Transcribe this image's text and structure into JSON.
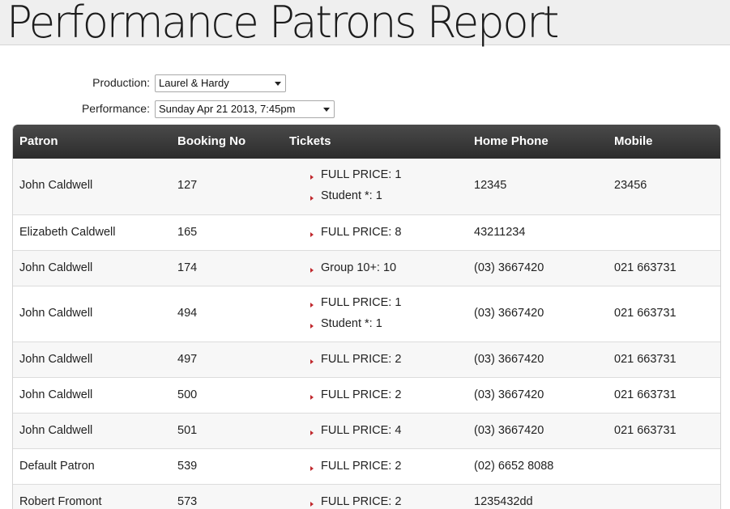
{
  "page": {
    "title": "Performance Patrons Report"
  },
  "filters": {
    "production": {
      "label": "Production:",
      "value": "Laurel & Hardy"
    },
    "performance": {
      "label": "Performance:",
      "value": "Sunday Apr 21 2013, 7:45pm"
    }
  },
  "table": {
    "headers": {
      "patron": "Patron",
      "booking_no": "Booking No",
      "tickets": "Tickets",
      "home_phone": "Home Phone",
      "mobile": "Mobile"
    },
    "rows": [
      {
        "patron": "John Caldwell",
        "booking_no": "127",
        "tickets": [
          "FULL PRICE: 1",
          "Student *: 1"
        ],
        "home_phone": "12345",
        "mobile": "23456"
      },
      {
        "patron": "Elizabeth Caldwell",
        "booking_no": "165",
        "tickets": [
          "FULL PRICE: 8"
        ],
        "home_phone": "43211234",
        "mobile": ""
      },
      {
        "patron": "John Caldwell",
        "booking_no": "174",
        "tickets": [
          "Group 10+: 10"
        ],
        "home_phone": "(03) 3667420",
        "mobile": "021 663731"
      },
      {
        "patron": "John Caldwell",
        "booking_no": "494",
        "tickets": [
          "FULL PRICE: 1",
          "Student *: 1"
        ],
        "home_phone": "(03) 3667420",
        "mobile": "021 663731"
      },
      {
        "patron": "John Caldwell",
        "booking_no": "497",
        "tickets": [
          "FULL PRICE: 2"
        ],
        "home_phone": "(03) 3667420",
        "mobile": "021 663731"
      },
      {
        "patron": "John Caldwell",
        "booking_no": "500",
        "tickets": [
          "FULL PRICE: 2"
        ],
        "home_phone": "(03) 3667420",
        "mobile": "021 663731"
      },
      {
        "patron": "John Caldwell",
        "booking_no": "501",
        "tickets": [
          "FULL PRICE: 4"
        ],
        "home_phone": "(03) 3667420",
        "mobile": "021 663731"
      },
      {
        "patron": "Default Patron",
        "booking_no": "539",
        "tickets": [
          "FULL PRICE: 2"
        ],
        "home_phone": "(02) 6652 8088",
        "mobile": ""
      },
      {
        "patron": "Robert Fromont",
        "booking_no": "573",
        "tickets": [
          "FULL PRICE: 2"
        ],
        "home_phone": "1235432dd",
        "mobile": ""
      }
    ]
  },
  "colors": {
    "header_bg": "#333333",
    "bullet": "#c0282d",
    "row_alt": "#f7f7f7"
  }
}
